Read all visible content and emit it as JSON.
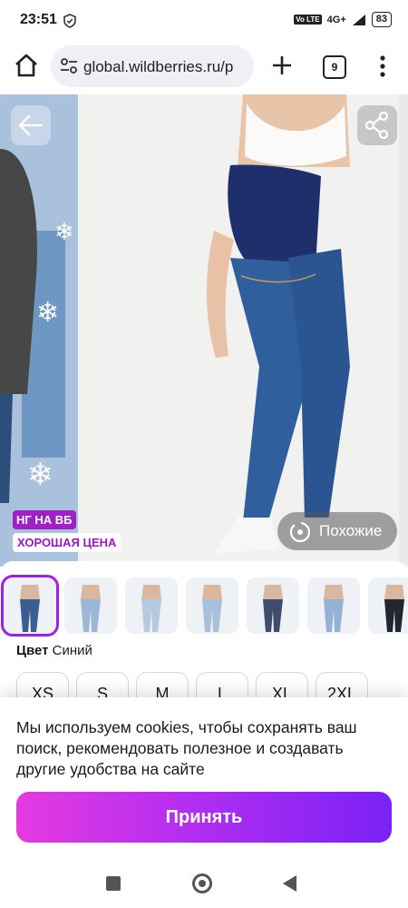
{
  "status_bar": {
    "time": "23:51",
    "network": "4G+",
    "volte": "Vo LTE",
    "battery": "83"
  },
  "browser": {
    "url": "global.wildberries.ru/p",
    "tab_count": "9"
  },
  "gallery": {
    "badge_ng": "НГ НА ВБ",
    "badge_price": "ХОРОШАЯ ЦЕНА",
    "similar_label": "Похожие"
  },
  "product": {
    "color_label": "Цвет",
    "color_value": "Синий",
    "thumbnails": [
      {
        "id": "thumb-1",
        "tint": "#3a5e8f",
        "selected": true
      },
      {
        "id": "thumb-2",
        "tint": "#9db6d6",
        "selected": false
      },
      {
        "id": "thumb-3",
        "tint": "#b7c9de",
        "selected": false
      },
      {
        "id": "thumb-4",
        "tint": "#a9c0db",
        "selected": false
      },
      {
        "id": "thumb-5",
        "tint": "#3d4d6a",
        "selected": false
      },
      {
        "id": "thumb-6",
        "tint": "#93b2d4",
        "selected": false
      },
      {
        "id": "thumb-7",
        "tint": "#222630",
        "selected": false
      }
    ],
    "sizes": [
      "XS",
      "S",
      "M",
      "L",
      "XL",
      "2XL"
    ]
  },
  "cookie_banner": {
    "text": "Мы используем cookies, чтобы сохранять ваш поиск, рекомендовать полезное и создавать другие удобства на сайте",
    "accept_label": "Принять"
  },
  "colors": {
    "accent_start": "#e43be0",
    "accent_end": "#7a22f5",
    "badge_purple": "#a020c8"
  }
}
